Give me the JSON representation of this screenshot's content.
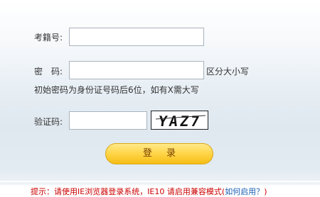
{
  "form": {
    "student_id_label": "考籍号:",
    "student_id_value": "",
    "password_label": "密　码:",
    "password_value": "",
    "case_hint": "区分大小写",
    "password_hint": "初始密码为身份证号码后6位，如有X需大写",
    "captcha_label": "验证码:",
    "captcha_value": "",
    "captcha_text": "YAZ7",
    "login_label": "登 录"
  },
  "footer": {
    "tip_text": "提示：请使用IE浏览器登录系统，IE10 请启用兼容模式(",
    "tip_link": "如何启用？",
    "tip_close": ")"
  },
  "colors": {
    "tip": "#cc0000",
    "link": "#1a5fb4",
    "button": "#ffd74d"
  }
}
